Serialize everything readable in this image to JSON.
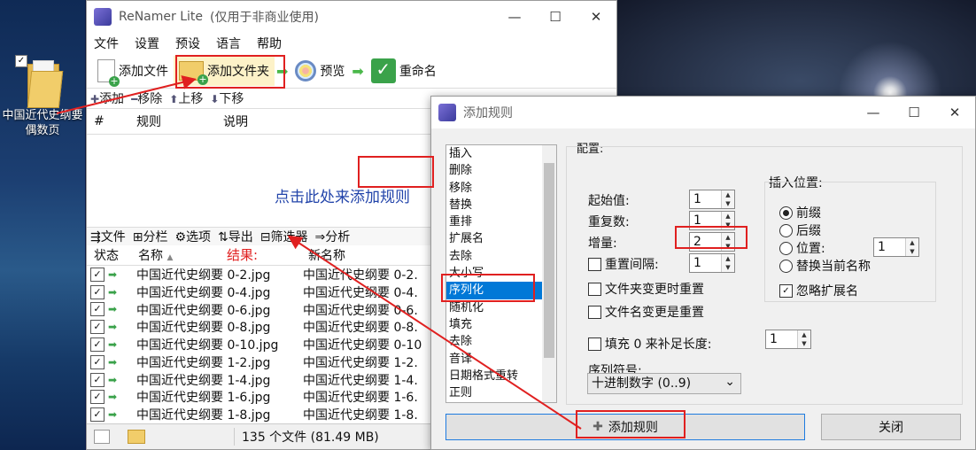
{
  "desktop": {
    "icon_label": "中国近代史纲要偶数页"
  },
  "main_window": {
    "title": "ReNamer Lite",
    "subtitle": "(仅用于非商业使用)",
    "menu": [
      "文件",
      "设置",
      "预设",
      "语言",
      "帮助"
    ],
    "toolbar": {
      "add_file": "添加文件",
      "add_folder": "添加文件夹",
      "preview": "预览",
      "rename": "重命名"
    },
    "rule_actions": {
      "add": "添加",
      "remove": "移除",
      "up": "上移",
      "down": "下移"
    },
    "rule_columns": [
      "#",
      "规则",
      "说明"
    ],
    "rule_hint_prefix": "点击此处来",
    "rule_hint_link": "添加规则",
    "lower_toolbar": [
      "文件",
      "分栏",
      "选项",
      "导出",
      "筛选器",
      "分析"
    ],
    "file_columns": {
      "state": "状态",
      "name": "名称",
      "newname": "新名称",
      "annotation": "结果:"
    },
    "files": [
      {
        "name": "中国近代史纲要 0-2.jpg",
        "newname": "中国近代史纲要 0-2."
      },
      {
        "name": "中国近代史纲要 0-4.jpg",
        "newname": "中国近代史纲要 0-4."
      },
      {
        "name": "中国近代史纲要 0-6.jpg",
        "newname": "中国近代史纲要 0-6."
      },
      {
        "name": "中国近代史纲要 0-8.jpg",
        "newname": "中国近代史纲要 0-8."
      },
      {
        "name": "中国近代史纲要 0-10.jpg",
        "newname": "中国近代史纲要 0-10"
      },
      {
        "name": "中国近代史纲要 1-2.jpg",
        "newname": "中国近代史纲要 1-2."
      },
      {
        "name": "中国近代史纲要 1-4.jpg",
        "newname": "中国近代史纲要 1-4."
      },
      {
        "name": "中国近代史纲要 1-6.jpg",
        "newname": "中国近代史纲要 1-6."
      },
      {
        "name": "中国近代史纲要 1-8.jpg",
        "newname": "中国近代史纲要 1-8."
      },
      {
        "name": "中国近代史纲要 1-10.jpg",
        "newname": "中国近代史纲要 1-10"
      }
    ],
    "status": "135 个文件 (81.49 MB)"
  },
  "dialog": {
    "title": "添加规则",
    "rules": [
      "插入",
      "删除",
      "移除",
      "替换",
      "重排",
      "扩展名",
      "去除",
      "大小写",
      "序列化",
      "随机化",
      "填充",
      "去除",
      "音译",
      "日期格式重转",
      "正则"
    ],
    "selected_rule": "序列化",
    "config_label": "配置:",
    "start_label": "起始值:",
    "start_value": "1",
    "repeat_label": "重复数:",
    "repeat_value": "1",
    "step_label": "增量:",
    "step_value": "2",
    "reset_every_label": "重置间隔:",
    "reset_every_value": "1",
    "reset_folder_label": "文件夹变更时重置",
    "reset_name_label": "文件名变更是重置",
    "pad_label": "填充 0 来补足长度:",
    "pad_value": "1",
    "sequence_label": "序列符号:",
    "sequence_value": "十进制数字 (0..9)",
    "insert_label": "插入位置:",
    "insert_options": [
      "前缀",
      "后缀",
      "位置:",
      "替换当前名称"
    ],
    "position_value": "1",
    "ignore_ext_label": "忽略扩展名",
    "add_button": "添加规则",
    "close_button": "关闭"
  }
}
